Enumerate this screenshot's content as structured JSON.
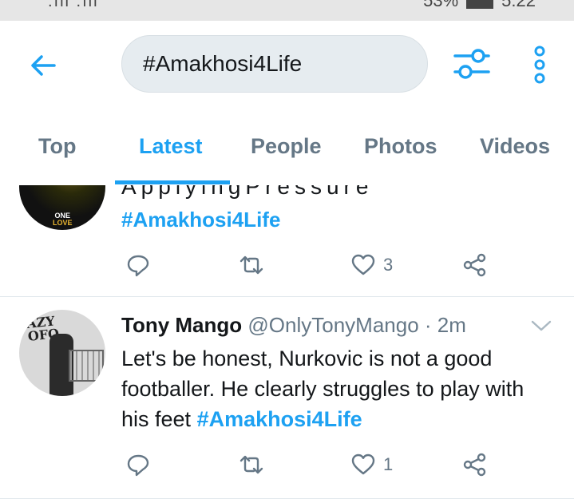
{
  "status_bar": {
    "signal": ".ıll .ıll",
    "battery": "53%",
    "time": "5:22"
  },
  "header": {
    "back_icon": "arrow-left-icon",
    "search_value": "#Amakhosi4Life",
    "filter_icon": "sliders-icon",
    "more_icon": "more-vertical-icon"
  },
  "tabs": [
    {
      "label": "Top",
      "active": false
    },
    {
      "label": "Latest",
      "active": true
    },
    {
      "label": "People",
      "active": false
    },
    {
      "label": "Photos",
      "active": false
    },
    {
      "label": "Videos",
      "active": false
    }
  ],
  "tweets": [
    {
      "partial_text": "ApplyingPressure",
      "hashtag": "#Amakhosi4Life",
      "avatar_text": "ONE",
      "avatar_text2": "LOVE",
      "likes": "3"
    },
    {
      "name": "Tony Mango",
      "handle": "@OnlyTonyMango",
      "time": "· 2m",
      "body": "Let's be honest, Nurkovic is not a good footballer. He clearly struggles to play with his feet ",
      "hashtag": "#Amakhosi4Life",
      "avatar_text": "AZY",
      "avatar_text2": "OFO",
      "likes": "1"
    }
  ],
  "colors": {
    "accent": "#1da1f2",
    "secondary_text": "#657786",
    "search_bg": "#e6ecf0",
    "divider": "#e1e8ed"
  }
}
